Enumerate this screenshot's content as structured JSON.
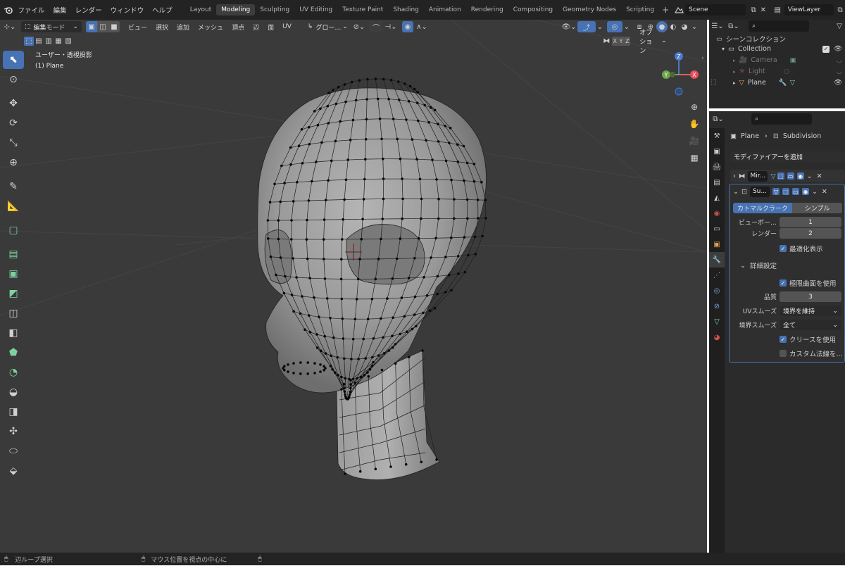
{
  "topbar": {
    "menus": [
      "ファイル",
      "編集",
      "レンダー",
      "ウィンドウ",
      "ヘルプ"
    ],
    "workspaces": [
      "Layout",
      "Modeling",
      "Sculpting",
      "UV Editing",
      "Texture Paint",
      "Shading",
      "Animation",
      "Rendering",
      "Compositing",
      "Geometry Nodes",
      "Scripting"
    ],
    "active_workspace": "Modeling",
    "add_tab": "+",
    "scene": "Scene",
    "view_layer": "ViewLayer"
  },
  "viewport": {
    "mode": "編集モード",
    "menus": [
      "ビュー",
      "選択",
      "追加",
      "メッシュ",
      "頂点",
      "辺",
      "面",
      "UV"
    ],
    "transform_orientation": "グロー…",
    "view_name": "ユーザー・透視投影",
    "object_name": "(1) Plane",
    "options": "オプション",
    "mirror_axes": [
      "X",
      "Y",
      "Z"
    ],
    "gizmo": {
      "z": "Z",
      "y": "Y",
      "x": "X"
    }
  },
  "outliner": {
    "title": "シーンコレクション",
    "items": [
      {
        "label": "Collection"
      },
      {
        "label": "Camera"
      },
      {
        "label": "Light"
      },
      {
        "label": "Plane"
      }
    ]
  },
  "properties": {
    "breadcrumb_object": "Plane",
    "breadcrumb_modifier": "Subdivision",
    "add_modifier": "モディファイアーを追加",
    "modifiers": [
      {
        "name": "Mir..."
      },
      {
        "name": "Su..."
      }
    ],
    "subdiv_types": [
      "カトマルクラーク",
      "シンプル"
    ],
    "active_subdiv_type": "カトマルクラーク",
    "viewport_label": "ビューポー…",
    "viewport_value": "1",
    "render_label": "レンダー",
    "render_value": "2",
    "optimal_display": "最適化表示",
    "advanced": "詳細設定",
    "use_limit_surface": "極限曲面を使用",
    "quality_label": "品質",
    "quality_value": "3",
    "uv_smooth_label": "UVスムーズ",
    "uv_smooth_value": "境界を維持",
    "boundary_smooth_label": "境界スムーズ",
    "boundary_smooth_value": "全て",
    "use_creases": "クリースを使用",
    "custom_normals": "カスタム法線を…"
  },
  "statusbar": {
    "left": "辺ループ選択",
    "middle": "マウス位置を視点の中心に"
  },
  "colors": {
    "accent": "#4772b3",
    "viewport_bg": "#3a3a3a",
    "panel_bg": "#2b2b2b",
    "header_bg": "#232323",
    "mesh": "#a8a8a8"
  }
}
